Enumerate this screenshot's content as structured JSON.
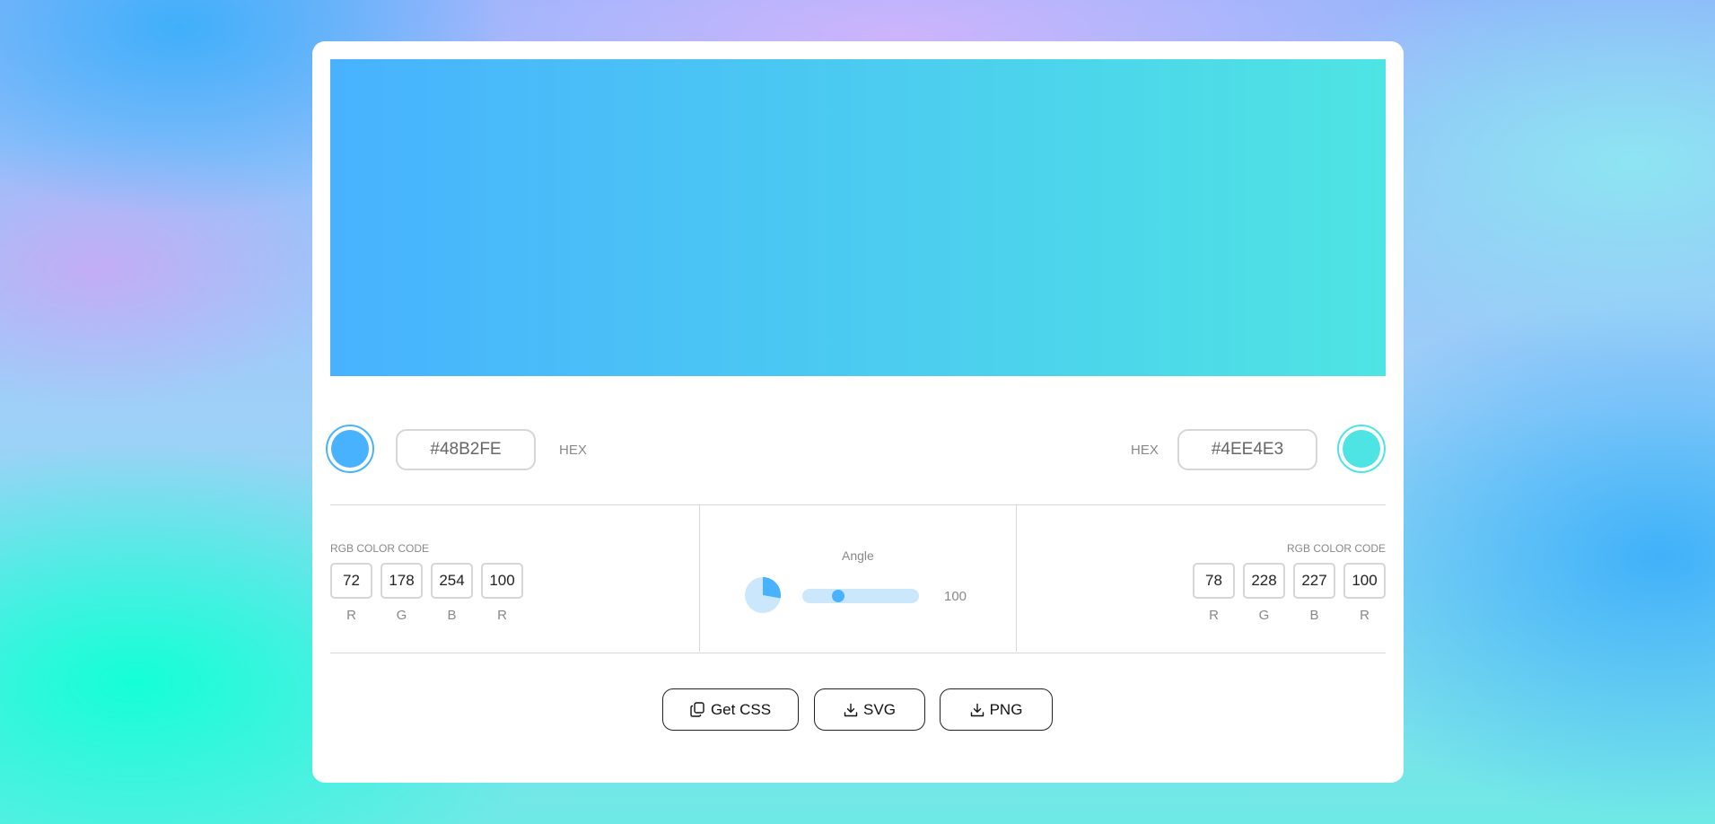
{
  "colors": {
    "start": "#48B2FE",
    "end": "#4EE4E3",
    "accent": "#48B2FE"
  },
  "left": {
    "hex_value": "#48B2FE",
    "hex_label": "HEX",
    "rgb_title": "RGB COLOR CODE",
    "rgb": [
      {
        "value": "72",
        "label": "R"
      },
      {
        "value": "178",
        "label": "G"
      },
      {
        "value": "254",
        "label": "B"
      },
      {
        "value": "100",
        "label": "R"
      }
    ]
  },
  "right": {
    "hex_value": "#4EE4E3",
    "hex_label": "HEX",
    "rgb_title": "RGB COLOR CODE",
    "rgb": [
      {
        "value": "78",
        "label": "R"
      },
      {
        "value": "228",
        "label": "G"
      },
      {
        "value": "227",
        "label": "B"
      },
      {
        "value": "100",
        "label": "R"
      }
    ]
  },
  "angle": {
    "title": "Angle",
    "value": "100",
    "slider_fraction": 0.31
  },
  "actions": {
    "css_label": "Get CSS",
    "svg_label": "SVG",
    "png_label": "PNG",
    "css_icon": "copy-icon",
    "svg_icon": "download-icon",
    "png_icon": "download-icon"
  }
}
